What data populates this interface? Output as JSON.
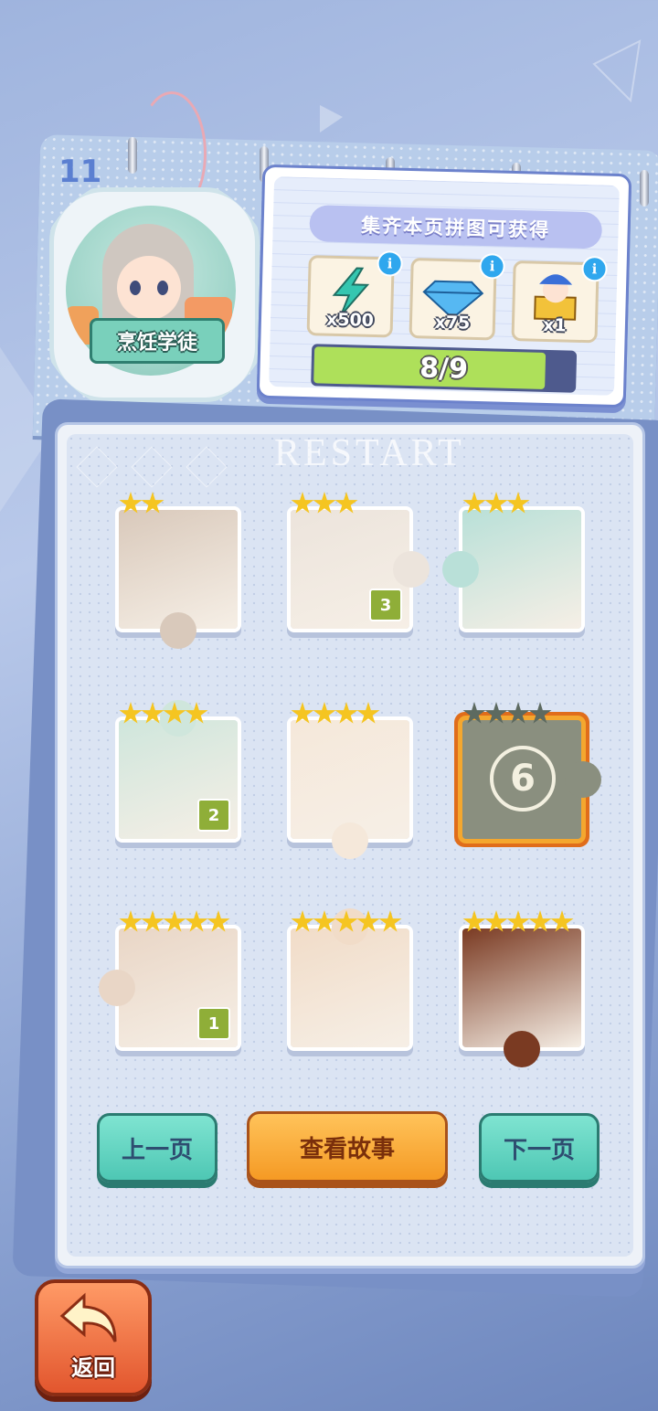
{
  "page_number": "11",
  "album_title": "烹饪学徒",
  "reward_panel": {
    "header": "集齐本页拼图可获得",
    "rewards": [
      {
        "icon": "energy-bolt-icon",
        "count": "x500",
        "info": "i"
      },
      {
        "icon": "diamond-gem-icon",
        "count": "x75",
        "info": "i"
      },
      {
        "icon": "jester-toy-icon",
        "count": "x1",
        "info": "i"
      }
    ],
    "progress_text": "8/9",
    "progress_fraction": 0.89
  },
  "watermark": "RESTART",
  "pieces": [
    {
      "stars": 2,
      "badge": "",
      "locked": false,
      "color": "#d9c9bb"
    },
    {
      "stars": 3,
      "badge": "3",
      "locked": false,
      "color": "#ece4dc"
    },
    {
      "stars": 3,
      "badge": "",
      "locked": false,
      "color": "#b9e0d8"
    },
    {
      "stars": 4,
      "badge": "2",
      "locked": false,
      "color": "#cfe6dc"
    },
    {
      "stars": 4,
      "badge": "",
      "locked": false,
      "color": "#f5e8da"
    },
    {
      "stars": 4,
      "badge": "6",
      "locked": true,
      "color": "#8a8f7f"
    },
    {
      "stars": 5,
      "badge": "1",
      "locked": false,
      "color": "#e9d6c6"
    },
    {
      "stars": 5,
      "badge": "",
      "locked": false,
      "color": "#f1dcc8"
    },
    {
      "stars": 5,
      "badge": "",
      "locked": false,
      "color": "#7a3a22"
    }
  ],
  "buttons": {
    "prev": "上一页",
    "story": "查看故事",
    "next": "下一页",
    "back": "返回"
  },
  "colors": {
    "accent_teal": "#4ec7b4",
    "accent_orange": "#f59a24",
    "star_gold": "#f5c521",
    "progress_green": "#aee05a"
  }
}
